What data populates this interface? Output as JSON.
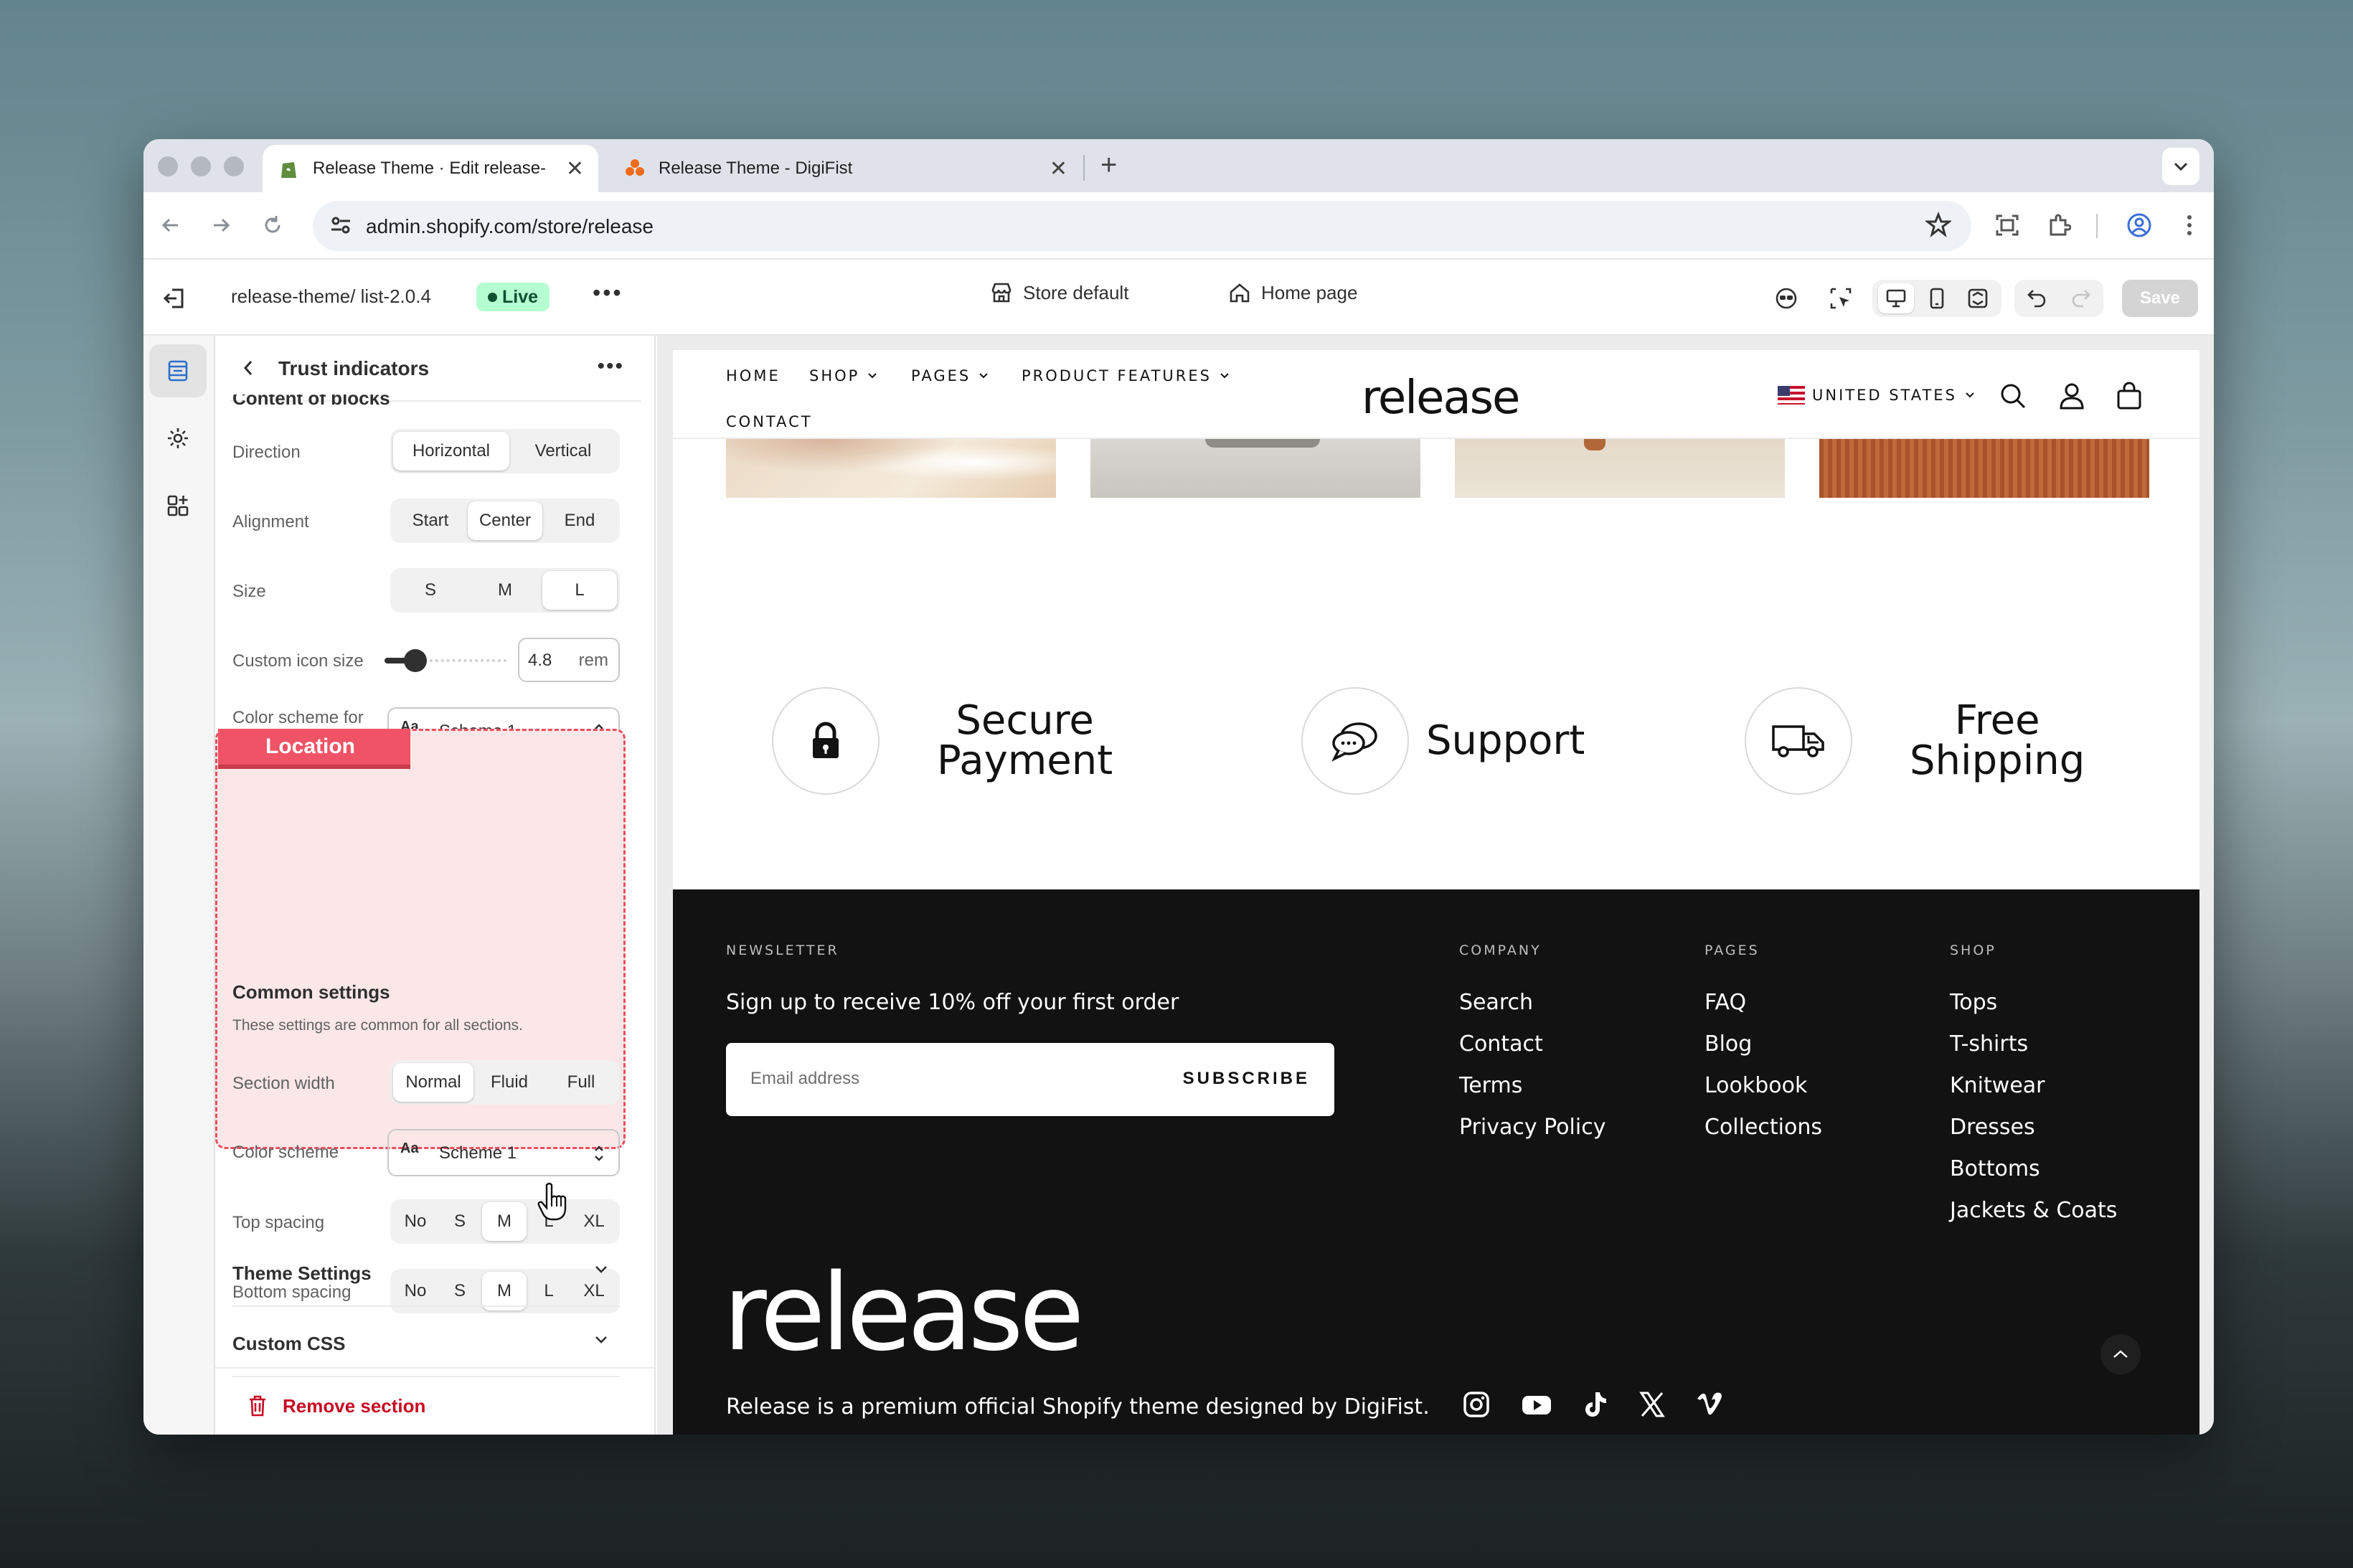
{
  "browser": {
    "tabs": [
      {
        "title": "Release Theme · Edit release-",
        "active": true,
        "icon": "shopify-icon"
      },
      {
        "title": "Release Theme - DigiFist",
        "active": false,
        "icon": "digifist-icon"
      }
    ],
    "url": "admin.shopify.com/store/release"
  },
  "editor_header": {
    "theme_name": "release-theme/ list-2.0.4",
    "status_badge": "Live",
    "store_selector": "Store default",
    "page_selector": "Home page",
    "save_label": "Save"
  },
  "panel": {
    "title": "Trust indicators",
    "clipped_heading": "Content of blocks",
    "direction": {
      "label": "Direction",
      "options": [
        "Horizontal",
        "Vertical"
      ],
      "selected": "Horizontal"
    },
    "alignment": {
      "label": "Alignment",
      "options": [
        "Start",
        "Center",
        "End"
      ],
      "selected": "Center"
    },
    "size": {
      "label": "Size",
      "options": [
        "S",
        "M",
        "L"
      ],
      "selected": "L"
    },
    "custom_icon_size": {
      "label": "Custom icon size",
      "value": "4.8",
      "unit": "rem",
      "slider_fraction": 0.22
    },
    "color_scheme_blocks": {
      "label": "Color scheme for blocks",
      "swatch": "Aa",
      "value": "Scheme 1"
    },
    "location_tag": "Location",
    "common": {
      "title": "Common settings",
      "description": "These settings are common for all sections.",
      "section_width": {
        "label": "Section width",
        "options": [
          "Normal",
          "Fluid",
          "Full"
        ],
        "selected": "Normal"
      },
      "color_scheme": {
        "label": "Color scheme",
        "swatch": "Aa",
        "value": "Scheme 1"
      },
      "top_spacing": {
        "label": "Top spacing",
        "options": [
          "No",
          "S",
          "M",
          "L",
          "XL"
        ],
        "selected": "M"
      },
      "bottom_spacing": {
        "label": "Bottom spacing",
        "options": [
          "No",
          "S",
          "M",
          "L",
          "XL"
        ],
        "selected": "M"
      }
    },
    "theme_settings": "Theme Settings",
    "custom_css": "Custom CSS",
    "remove_section": "Remove section"
  },
  "store": {
    "nav": {
      "home": "HOME",
      "shop": "SHOP",
      "pages": "PAGES",
      "product_features": "PRODUCT FEATURES",
      "contact": "CONTACT"
    },
    "logo": "release",
    "country": "UNITED STATES",
    "trust": [
      {
        "icon": "lock-icon",
        "line1": "Secure",
        "line2": "Payment"
      },
      {
        "icon": "chat-icon",
        "line1": "Support",
        "line2": ""
      },
      {
        "icon": "truck-icon",
        "line1": "Free",
        "line2": "Shipping"
      }
    ],
    "footer": {
      "newsletter_heading": "NEWSLETTER",
      "newsletter_text": "Sign up to receive 10% off your first order",
      "email_placeholder": "Email address",
      "subscribe": "SUBSCRIBE",
      "company": {
        "heading": "COMPANY",
        "links": [
          "Search",
          "Contact",
          "Terms",
          "Privacy Policy"
        ]
      },
      "pages": {
        "heading": "PAGES",
        "links": [
          "FAQ",
          "Blog",
          "Lookbook",
          "Collections"
        ]
      },
      "shop": {
        "heading": "SHOP",
        "links": [
          "Tops",
          "T-shirts",
          "Knitwear",
          "Dresses",
          "Bottoms",
          "Jackets & Coats"
        ]
      },
      "big_logo": "release",
      "tagline": "Release is a premium official Shopify theme designed by DigiFist.",
      "social": [
        "instagram-icon",
        "youtube-icon",
        "tiktok-icon",
        "x-icon",
        "vimeo-icon"
      ]
    }
  },
  "colors": {
    "live_badge": "#b4fed2",
    "location_highlight": "#f05366",
    "footer_bg": "#121212",
    "remove": "#c70a24"
  }
}
